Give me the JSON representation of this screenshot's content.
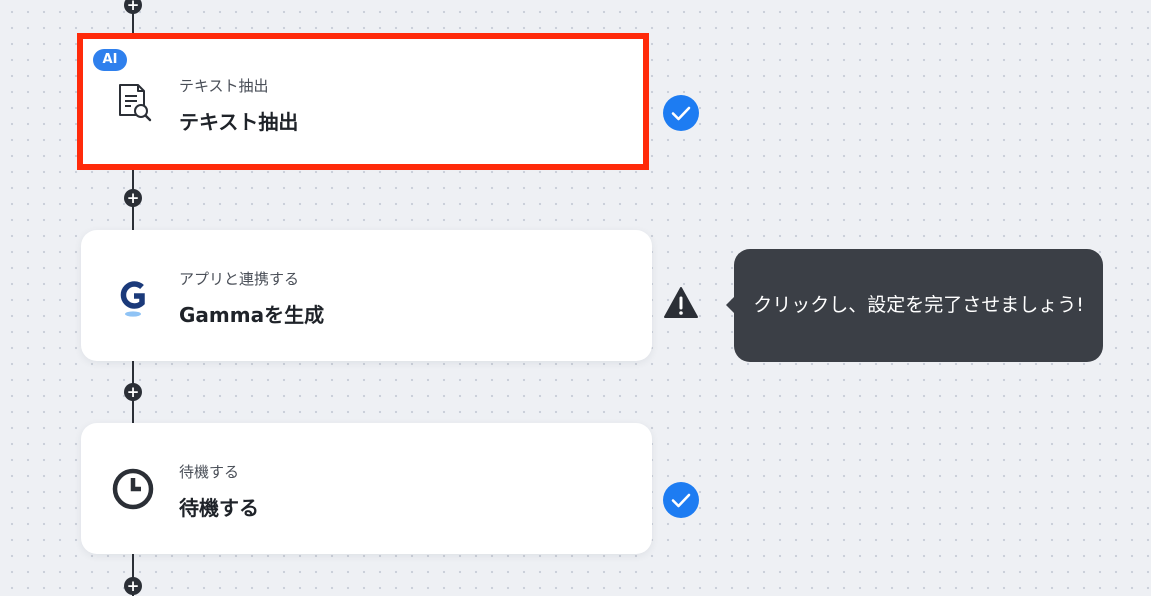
{
  "steps": [
    {
      "badge": "AI",
      "subtitle": "テキスト抽出",
      "title": "テキスト抽出",
      "icon": "document-search-icon",
      "status": "complete"
    },
    {
      "subtitle": "アプリと連携する",
      "title": "Gammaを生成",
      "icon": "gamma-logo",
      "status": "warning"
    },
    {
      "subtitle": "待機する",
      "title": "待機する",
      "icon": "clock-icon",
      "status": "complete"
    }
  ],
  "tooltip": {
    "text": "クリックし、設定を完了させましょう!"
  },
  "add_button_label": "+",
  "colors": {
    "selection_border": "#ff2a0a",
    "complete": "#1d7cf2",
    "warning": "#2b2f36",
    "ai_badge": "#2f80ed",
    "tooltip_bg": "#3b3f46",
    "gamma_blue": "#1b3a7a"
  }
}
